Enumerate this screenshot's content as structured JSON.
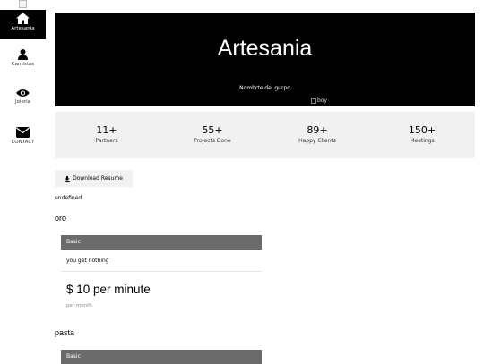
{
  "sidebar": {
    "items": [
      {
        "label": "Artesania",
        "icon": "home-icon"
      },
      {
        "label": "Camistas",
        "icon": "user-icon"
      },
      {
        "label": "Joieria",
        "icon": "eye-icon"
      },
      {
        "label": "CONTACT",
        "icon": "envelope-icon"
      }
    ]
  },
  "hero": {
    "title": "Artesania",
    "subtitle": "Nombrte del gurpo",
    "image_alt": "boy"
  },
  "stats": [
    {
      "value": "11+",
      "label": "Partners"
    },
    {
      "value": "55+",
      "label": "Projects Done"
    },
    {
      "value": "89+",
      "label": "Happy Clients"
    },
    {
      "value": "150+",
      "label": "Meetings"
    }
  ],
  "download_label": "Download Resume",
  "undefined_text": "undefined",
  "packages": [
    {
      "title": "oro",
      "tier": "Basic",
      "description": "you get nothing",
      "price": "$ 10 per minute",
      "period": "per month"
    },
    {
      "title": "pasta",
      "tier": "Basic"
    }
  ],
  "colors": {
    "active_sidebar": "#000000",
    "hero_bg": "#000000",
    "stats_bg": "#f1f1f1",
    "card_header_bg": "#6b6b6b"
  }
}
